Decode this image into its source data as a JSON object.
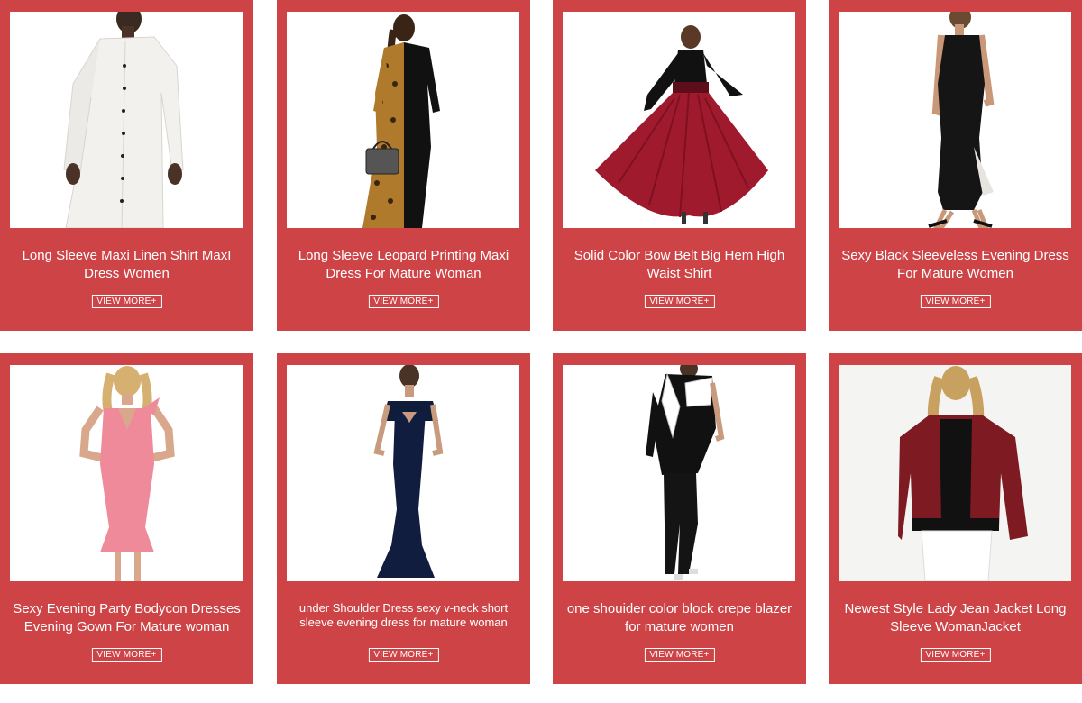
{
  "products": [
    {
      "title": "Long Sleeve Maxi Linen Shirt MaxI Dress Women",
      "button": "VIEW MORE+",
      "image": "white-shirt-dress-photo"
    },
    {
      "title": "Long Sleeve Leopard Printing Maxi Dress For Mature Woman",
      "button": "VIEW MORE+",
      "image": "leopard-black-dress-photo"
    },
    {
      "title": "Solid Color Bow Belt Big Hem High Waist Shirt",
      "button": "VIEW MORE+",
      "image": "red-skirt-black-top-photo"
    },
    {
      "title": "Sexy Black Sleeveless Evening Dress For Mature Women",
      "button": "VIEW MORE+",
      "image": "black-slip-dress-photo"
    },
    {
      "title": "Sexy Evening Party Bodycon Dresses Evening Gown For Mature woman",
      "button": "VIEW MORE+",
      "image": "pink-bodycon-dress-photo"
    },
    {
      "title": "under Shoulder Dress sexy v-neck short sleeve evening dress for mature woman",
      "button": "VIEW MORE+",
      "image": "navy-off-shoulder-gown-photo"
    },
    {
      "title": "one shouider color block crepe blazer for mature women",
      "button": "VIEW MORE+",
      "image": "black-white-blazer-photo"
    },
    {
      "title": "Newest Style Lady Jean Jacket Long Sleeve WomanJacket",
      "button": "VIEW MORE+",
      "image": "burgundy-bomber-jacket-photo"
    }
  ],
  "colors": {
    "card_background": "#cd4346",
    "text": "#ffffff",
    "image_background": "#ffffff"
  }
}
